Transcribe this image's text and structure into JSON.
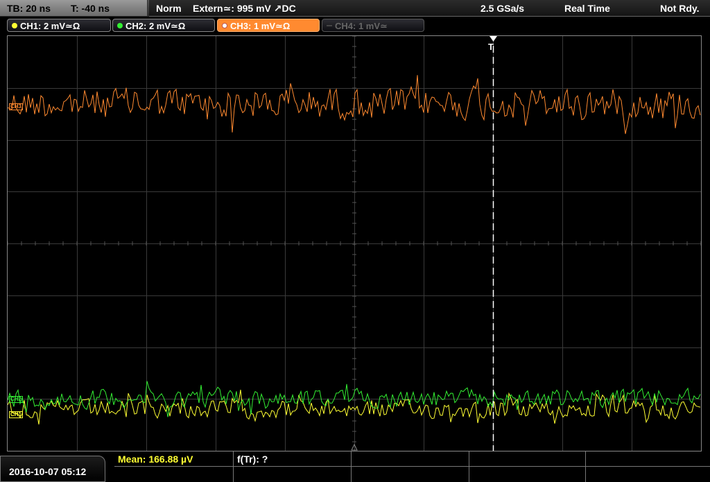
{
  "topbar": {
    "timebase": "TB: 20 ns",
    "trigger_offset": "T: -40 ns",
    "trigger_mode": "Norm",
    "trigger_source": "Extern≃: 995 mV ↗DC",
    "sample_rate": "2.5 GSa/s",
    "acq_mode": "Real Time",
    "status": "Not Rdy."
  },
  "channels": [
    {
      "label": "CH1: 2 mV≃Ω",
      "color": "#ffff33",
      "active": true
    },
    {
      "label": "CH2: 2 mV≃Ω",
      "color": "#33ee33",
      "active": true
    },
    {
      "label": "CH3: 1 mV≃Ω",
      "color": "#ff8a30",
      "active": true
    },
    {
      "label": "CH4: 1 mV≃",
      "color": "#666666",
      "active": false
    }
  ],
  "markers": {
    "ch1": "CH1",
    "ch2": "CH2",
    "ch3": "CH3",
    "trigger": "T"
  },
  "bottom": {
    "datetime": "2016-10-07 05:12",
    "measurement_1": "Mean: 166.88 µV",
    "measurement_2": "f(Tr): ?"
  },
  "colors": {
    "ch1": "#ffff33",
    "ch2": "#33ee33",
    "ch3": "#ff8a30",
    "grid": "#3a3a3a",
    "trigger_line": "#ffffff"
  }
}
